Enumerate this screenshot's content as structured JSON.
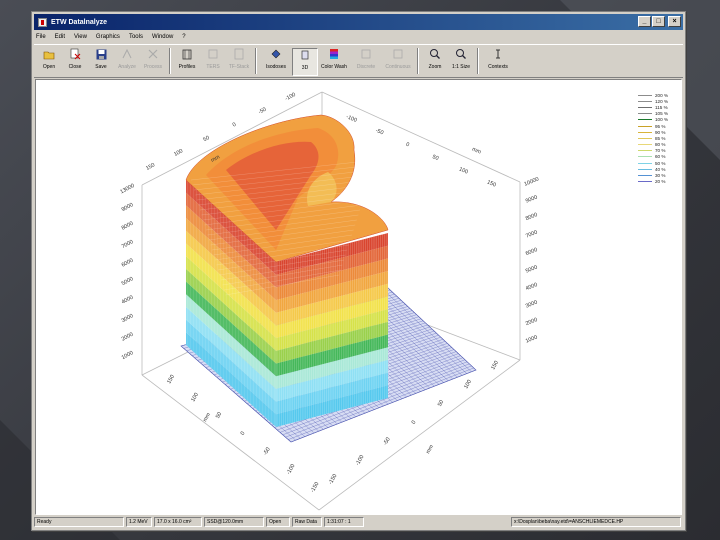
{
  "window": {
    "title": "ETW Datalnalyze",
    "controls": [
      "_",
      "□",
      "×"
    ]
  },
  "menu": [
    "File",
    "Edit",
    "View",
    "Graphics",
    "Tools",
    "Window",
    "?"
  ],
  "toolbar": [
    {
      "label": "Open",
      "icon": "folder-open-icon",
      "enabled": true
    },
    {
      "label": "Close",
      "icon": "close-doc-icon",
      "enabled": true
    },
    {
      "label": "Save",
      "icon": "floppy-disk-icon",
      "enabled": true
    },
    {
      "label": "Analyze",
      "icon": "analyze-icon",
      "enabled": false
    },
    {
      "label": "Process",
      "icon": "process-tools-icon",
      "enabled": false
    },
    {
      "label": "Profiles",
      "icon": "profiles-icon",
      "enabled": true
    },
    {
      "label": "TERS",
      "icon": "ters-icon",
      "enabled": false
    },
    {
      "label": "TF-Stack",
      "icon": "tf-stack-icon",
      "enabled": false
    },
    {
      "label": "Isodoses",
      "icon": "isodoses-icon",
      "enabled": true
    },
    {
      "label": "3D",
      "icon": "cube-3d-icon",
      "enabled": true,
      "pressed": true
    },
    {
      "label": "Color Wash",
      "icon": "color-wash-icon",
      "enabled": true
    },
    {
      "label": "Discrete",
      "icon": "discrete-icon",
      "enabled": false
    },
    {
      "label": "Continuous",
      "icon": "continuous-icon",
      "enabled": false
    },
    {
      "label": "Zoom",
      "icon": "zoom-icon",
      "enabled": true
    },
    {
      "label": "1:1 Size",
      "icon": "one-to-one-icon",
      "enabled": true
    },
    {
      "label": "Contexts",
      "icon": "contexts-icon",
      "enabled": true
    }
  ],
  "legend": [
    {
      "label": "200 %",
      "color": "#8c8c8c"
    },
    {
      "label": "120 %",
      "color": "#8c8c8c"
    },
    {
      "label": "115 %",
      "color": "#6e6e6e"
    },
    {
      "label": "105 %",
      "color": "#8c8c8c"
    },
    {
      "label": "100 %",
      "color": "#1b7a2e"
    },
    {
      "label": "95 %",
      "color": "#c9a227"
    },
    {
      "label": "90 %",
      "color": "#d8b43a"
    },
    {
      "label": "85 %",
      "color": "#e0c85a"
    },
    {
      "label": "80 %",
      "color": "#e8d878"
    },
    {
      "label": "70 %",
      "color": "#cdd96c"
    },
    {
      "label": "60 %",
      "color": "#a9e0b0"
    },
    {
      "label": "50 %",
      "color": "#7fd3e6"
    },
    {
      "label": "40 %",
      "color": "#69bde0"
    },
    {
      "label": "30 %",
      "color": "#5592d4"
    },
    {
      "label": "20 %",
      "color": "#6a6ac8"
    }
  ],
  "axes": {
    "right_axis_ticks": [
      "10000",
      "9000",
      "8000",
      "7000",
      "6000",
      "5000",
      "4000",
      "3000",
      "2000",
      "1000"
    ],
    "left_axis_ticks": [
      "13000",
      "9000",
      "8000",
      "7000",
      "6000",
      "5000",
      "4000",
      "3000",
      "2000",
      "1000"
    ],
    "front_left_ticks": [
      "150",
      "100",
      "50",
      "0",
      "-50",
      "-100",
      "-150"
    ],
    "front_right_ticks": [
      "150",
      "100",
      "50",
      "0",
      "-50",
      "-100",
      "-150"
    ],
    "unit_label": "mm"
  },
  "status": [
    "Ready",
    "1.2 MeV",
    "17.0 x 16.0 cm²",
    "SSD@120.0mm",
    "Open",
    "Raw Data",
    "1:31:07 : 1",
    "x:\\Dosplan\\beba\\nay.etd\\=ANSCHLIEMEDCE.HP"
  ]
}
